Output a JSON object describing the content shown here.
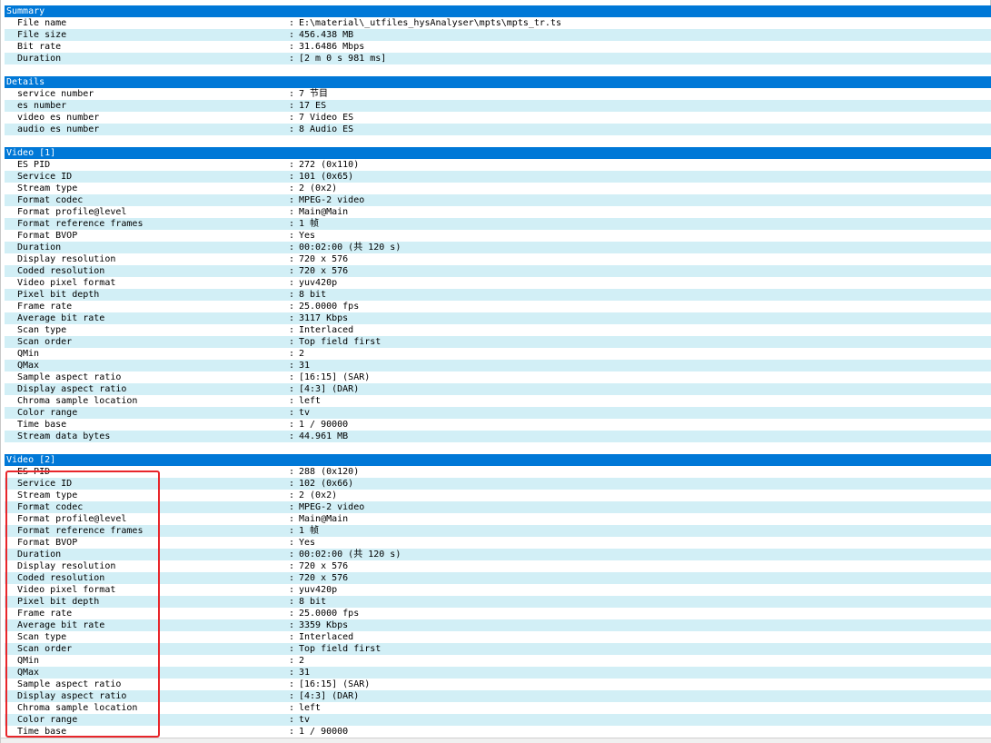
{
  "sections": [
    {
      "title": "Summary",
      "rows": [
        {
          "key": "File name",
          "value": "E:\\material\\_utfiles_hysAnalyser\\mpts\\mpts_tr.ts"
        },
        {
          "key": "File size",
          "value": "456.438 MB"
        },
        {
          "key": "Bit rate",
          "value": "31.6486 Mbps"
        },
        {
          "key": "Duration",
          "value": "[2 m 0 s 981 ms]"
        }
      ]
    },
    {
      "title": "Details",
      "rows": [
        {
          "key": "service number",
          "value": "7 节目"
        },
        {
          "key": "es number",
          "value": "17 ES"
        },
        {
          "key": "video es number",
          "value": "7 Video ES"
        },
        {
          "key": "audio es number",
          "value": "8 Audio ES"
        }
      ]
    },
    {
      "title": "Video [1]",
      "rows": [
        {
          "key": "ES PID",
          "value": "272 (0x110)"
        },
        {
          "key": "Service ID",
          "value": "101 (0x65)"
        },
        {
          "key": "Stream type",
          "value": "2 (0x2)"
        },
        {
          "key": "Format codec",
          "value": "MPEG-2 video"
        },
        {
          "key": "Format profile@level",
          "value": "Main@Main"
        },
        {
          "key": "Format reference frames",
          "value": "1 帧"
        },
        {
          "key": "Format BVOP",
          "value": "Yes"
        },
        {
          "key": "Duration",
          "value": "00:02:00 (共 120 s)"
        },
        {
          "key": "Display resolution",
          "value": "720 x 576"
        },
        {
          "key": "Coded resolution",
          "value": "720 x 576"
        },
        {
          "key": "Video pixel format",
          "value": "yuv420p"
        },
        {
          "key": "Pixel bit depth",
          "value": "8 bit"
        },
        {
          "key": "Frame rate",
          "value": "25.0000 fps"
        },
        {
          "key": "Average bit rate",
          "value": "3117 Kbps"
        },
        {
          "key": "Scan type",
          "value": "Interlaced"
        },
        {
          "key": "Scan order",
          "value": "Top field first"
        },
        {
          "key": "QMin",
          "value": "2"
        },
        {
          "key": "QMax",
          "value": "31"
        },
        {
          "key": "Sample aspect ratio",
          "value": "[16:15] (SAR)"
        },
        {
          "key": "Display aspect ratio",
          "value": "[4:3] (DAR)"
        },
        {
          "key": "Chroma sample location",
          "value": "left"
        },
        {
          "key": "Color range",
          "value": "tv"
        },
        {
          "key": "Time base",
          "value": "1 / 90000"
        },
        {
          "key": "Stream data bytes",
          "value": "44.961 MB"
        }
      ]
    },
    {
      "title": "Video [2]",
      "rows": [
        {
          "key": "ES PID",
          "value": "288 (0x120)"
        },
        {
          "key": "Service ID",
          "value": "102 (0x66)"
        },
        {
          "key": "Stream type",
          "value": "2 (0x2)"
        },
        {
          "key": "Format codec",
          "value": "MPEG-2 video"
        },
        {
          "key": "Format profile@level",
          "value": "Main@Main"
        },
        {
          "key": "Format reference frames",
          "value": "1 帧"
        },
        {
          "key": "Format BVOP",
          "value": "Yes"
        },
        {
          "key": "Duration",
          "value": "00:02:00 (共 120 s)"
        },
        {
          "key": "Display resolution",
          "value": "720 x 576"
        },
        {
          "key": "Coded resolution",
          "value": "720 x 576"
        },
        {
          "key": "Video pixel format",
          "value": "yuv420p"
        },
        {
          "key": "Pixel bit depth",
          "value": "8 bit"
        },
        {
          "key": "Frame rate",
          "value": "25.0000 fps"
        },
        {
          "key": "Average bit rate",
          "value": "3359 Kbps"
        },
        {
          "key": "Scan type",
          "value": "Interlaced"
        },
        {
          "key": "Scan order",
          "value": "Top field first"
        },
        {
          "key": "QMin",
          "value": "2"
        },
        {
          "key": "QMax",
          "value": "31"
        },
        {
          "key": "Sample aspect ratio",
          "value": "[16:15] (SAR)"
        },
        {
          "key": "Display aspect ratio",
          "value": "[4:3] (DAR)"
        },
        {
          "key": "Chroma sample location",
          "value": "left"
        },
        {
          "key": "Color range",
          "value": "tv"
        },
        {
          "key": "Time base",
          "value": "1 / 90000"
        }
      ]
    }
  ],
  "separator": ":",
  "colors": {
    "header_bg": "#0078d7",
    "header_text": "#ffffff",
    "row_alt_bg": "#d2eff6",
    "highlight_border": "#e8262b"
  }
}
